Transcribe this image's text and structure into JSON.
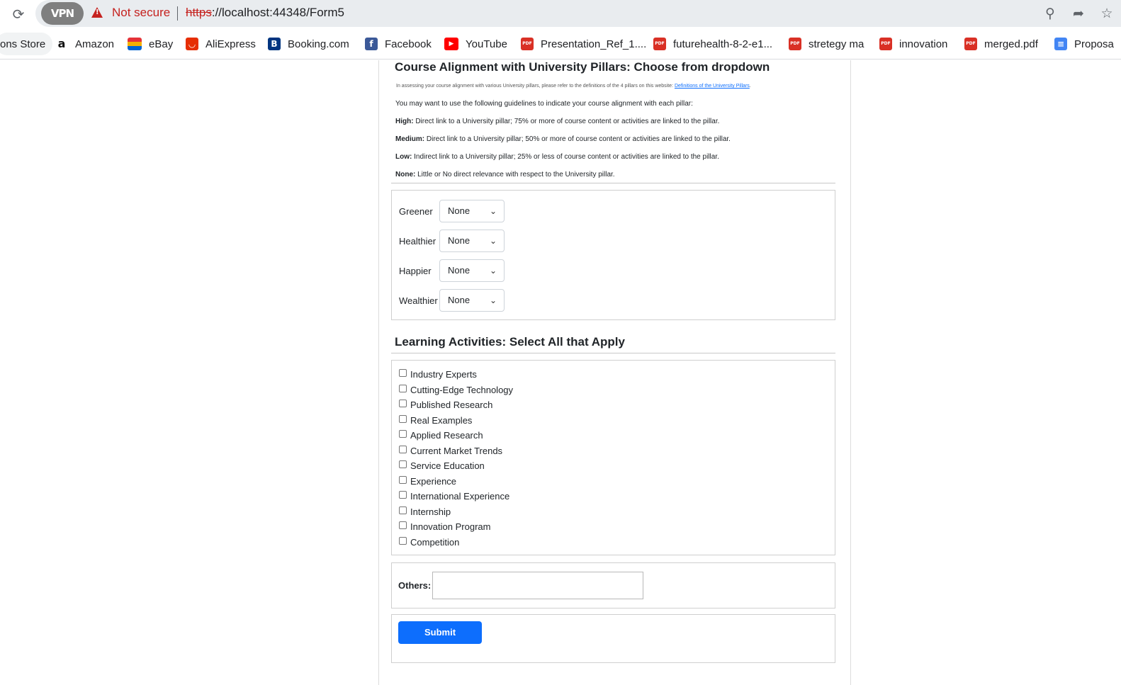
{
  "browser": {
    "vpn_label": "VPN",
    "security_text": "Not secure",
    "url_scheme": "https",
    "url_rest": "://localhost:44348/Form5",
    "bookmarks": [
      {
        "label": "ons Store",
        "icon": "store-icon"
      },
      {
        "label": "Amazon",
        "icon": "amazon-icon"
      },
      {
        "label": "eBay",
        "icon": "ebay-icon"
      },
      {
        "label": "AliExpress",
        "icon": "aliexpress-icon"
      },
      {
        "label": "Booking.com",
        "icon": "booking-icon"
      },
      {
        "label": "Facebook",
        "icon": "facebook-icon"
      },
      {
        "label": "YouTube",
        "icon": "youtube-icon"
      },
      {
        "label": "Presentation_Ref_1....",
        "icon": "pdf-icon"
      },
      {
        "label": "futurehealth-8-2-e1...",
        "icon": "pdf-icon"
      },
      {
        "label": "stretegy ma",
        "icon": "pdf-icon"
      },
      {
        "label": "innovation",
        "icon": "pdf-icon"
      },
      {
        "label": "merged.pdf",
        "icon": "pdf-icon"
      },
      {
        "label": "Proposa",
        "icon": "docs-icon"
      }
    ]
  },
  "alignment": {
    "heading": "Course Alignment with University Pillars: Choose from dropdown",
    "intro_text": "In assessing your course alignment with various University pillars, please refer to the definitions of the 4 pillars on this website: ",
    "intro_link": "Definitions of the University Pillars",
    "intro_end": ".",
    "guideline_intro": "You may want to use the following guidelines to indicate your course alignment with each pillar:",
    "guidelines": [
      {
        "level": "High:",
        "text": " Direct link to a University pillar; 75% or more of course content or activities are linked to the pillar."
      },
      {
        "level": "Medium:",
        "text": " Direct link to a University pillar; 50% or more of course content or activities are linked to the pillar."
      },
      {
        "level": "Low:",
        "text": " Indirect link to a University pillar; 25% or less of course content or activities are linked to the pillar."
      },
      {
        "level": "None:",
        "text": " Little or No direct relevance with respect to the University pillar."
      }
    ],
    "pillars": [
      {
        "label": "Greener",
        "value": "None"
      },
      {
        "label": "Healthier",
        "value": "None"
      },
      {
        "label": "Happier",
        "value": "None"
      },
      {
        "label": "Wealthier",
        "value": "None"
      }
    ]
  },
  "activities": {
    "heading": "Learning Activities: Select All that Apply",
    "items": [
      "Industry Experts",
      "Cutting-Edge Technology",
      "Published Research",
      "Real Examples",
      "Applied Research",
      "Current Market Trends",
      "Service Education",
      "Experience",
      "International Experience",
      "Internship",
      "Innovation Program",
      "Competition"
    ]
  },
  "others": {
    "label": "Others:",
    "value": ""
  },
  "submit_label": "Submit",
  "colors": {
    "primary": "#0d6efd",
    "danger": "#c5221f"
  }
}
